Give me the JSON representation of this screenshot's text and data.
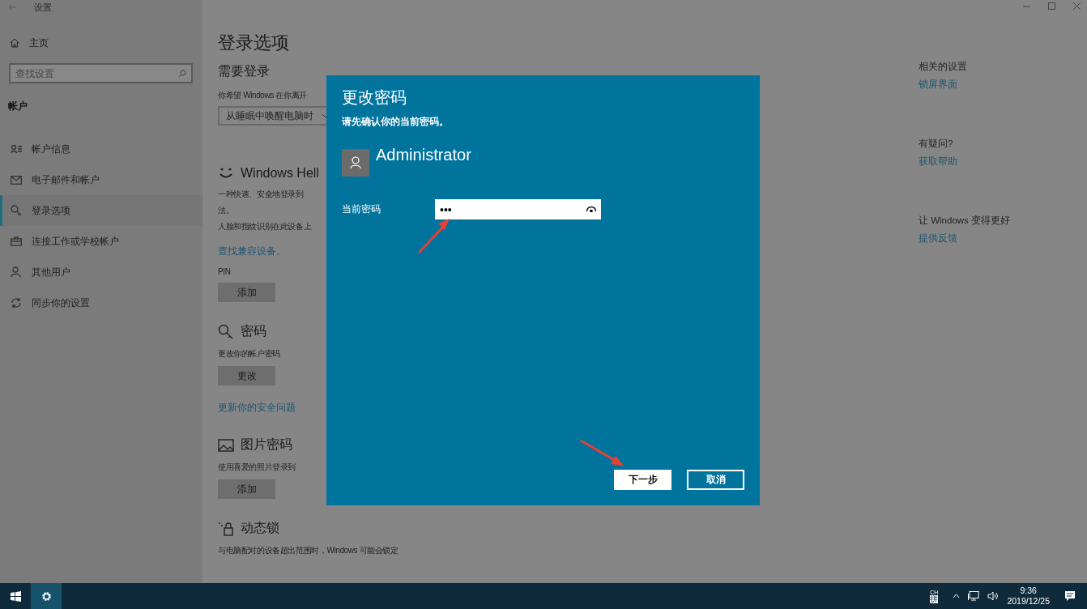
{
  "window": {
    "title": "设置"
  },
  "sidebar": {
    "home": "主页",
    "search": {
      "placeholder": "查找设置"
    },
    "group": "帐户",
    "items": [
      {
        "label": "帐户信息",
        "selected": false
      },
      {
        "label": "电子邮件和帐户",
        "selected": false
      },
      {
        "label": "登录选项",
        "selected": true
      },
      {
        "label": "连接工作或学校帐户",
        "selected": false
      },
      {
        "label": "其他用户",
        "selected": false
      },
      {
        "label": "同步你的设置",
        "selected": false
      }
    ]
  },
  "main": {
    "title": "登录选项",
    "blocks": [
      {
        "kind": "subtitle",
        "text": "需要登录"
      },
      {
        "kind": "text",
        "text": "你希望 Windows 在你离开"
      },
      {
        "kind": "dropdown",
        "text": "从睡眠中唤醒电脑时"
      },
      {
        "kind": "section",
        "text": "Windows Hell"
      },
      {
        "kind": "text",
        "text": "一种快速、安全地登录到"
      },
      {
        "kind": "text",
        "text": "法。"
      },
      {
        "kind": "text",
        "text": "人脸和指纹识别在此设备上"
      },
      {
        "kind": "link",
        "text": "查找兼容设备。"
      },
      {
        "kind": "text",
        "text": "PIN"
      },
      {
        "kind": "button",
        "text": "添加"
      },
      {
        "kind": "section",
        "text": "密码"
      },
      {
        "kind": "text",
        "text": "更改你的帐户密码"
      },
      {
        "kind": "button",
        "text": "更改"
      },
      {
        "kind": "link",
        "text": "更新你的安全问题"
      },
      {
        "kind": "section",
        "text": "图片密码"
      },
      {
        "kind": "text",
        "text": "使用喜爱的照片登录到"
      },
      {
        "kind": "button",
        "text": "添加"
      },
      {
        "kind": "section",
        "text": "动态锁"
      },
      {
        "kind": "text",
        "text": "与电脑配对的设备超出范围时，Windows 可能会锁定"
      }
    ]
  },
  "related": [
    {
      "heading": "相关的设置",
      "link": "锁屏界面"
    },
    {
      "heading": "有疑问?",
      "link": "获取帮助"
    },
    {
      "heading": "让 Windows 变得更好",
      "link": "提供反馈"
    }
  ],
  "dialog": {
    "title": "更改密码",
    "subtitle": "请先确认你的当前密码。",
    "user": "Administrator",
    "field_label": "当前密码",
    "field_value": "•••",
    "buttons": [
      {
        "label": "下一步",
        "primary": true
      },
      {
        "label": "取消",
        "primary": false
      }
    ]
  },
  "taskbar": {
    "ime_top": "CH",
    "ime_bottom": "拼",
    "time": "9:36",
    "date": "2019/12/25"
  }
}
